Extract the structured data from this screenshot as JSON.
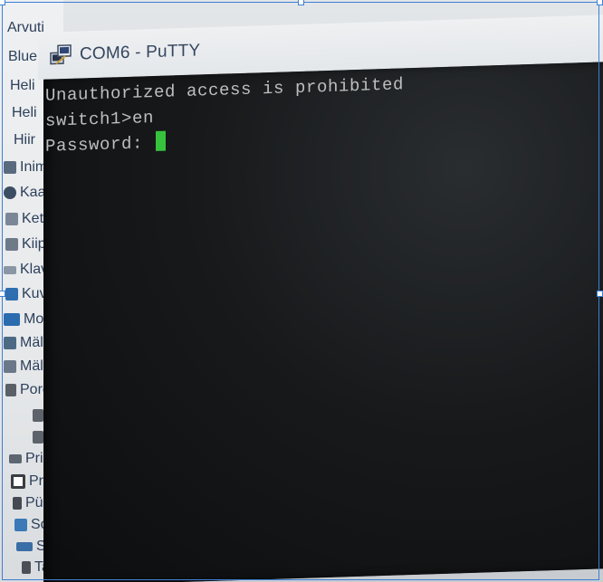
{
  "window": {
    "title": "COM6 - PuTTY",
    "icon": "putty-icon"
  },
  "terminal": {
    "lines": [
      "Unauthorized access is prohibited",
      "switch1>en",
      "Password: "
    ],
    "cursor_color": "#37c23e",
    "text_color": "#bdbfbf",
    "background_color": "#101214"
  },
  "device_manager": {
    "items": [
      {
        "label": "Arvuti",
        "icon": "computer-icon"
      },
      {
        "label": "Blue",
        "icon": "bluetooth-icon"
      },
      {
        "label": "Heli",
        "icon": "audio-icon"
      },
      {
        "label": "Heli",
        "icon": "audio-icon"
      },
      {
        "label": "Hiir",
        "icon": "mouse-icon"
      },
      {
        "label": "Inim",
        "icon": "hid-icon"
      },
      {
        "label": "Kaa",
        "icon": "disk-icon"
      },
      {
        "label": "Kett",
        "icon": "drive-icon"
      },
      {
        "label": "Kiip",
        "icon": "chip-icon"
      },
      {
        "label": "Klav",
        "icon": "keyboard-icon"
      },
      {
        "label": "Kuv",
        "icon": "display-adapter-icon"
      },
      {
        "label": "Mon",
        "icon": "monitor-icon"
      },
      {
        "label": "Mäl",
        "icon": "memory-icon"
      },
      {
        "label": "Mäl",
        "icon": "storage-icon"
      },
      {
        "label": "Porc",
        "icon": "port-icon"
      },
      {
        "label": "",
        "icon": "port-icon"
      },
      {
        "label": "",
        "icon": "port-icon"
      },
      {
        "label": "Prin",
        "icon": "printer-icon"
      },
      {
        "label": "Prot",
        "icon": "processor-icon"
      },
      {
        "label": "Püs",
        "icon": "firmware-icon"
      },
      {
        "label": "Soft",
        "icon": "software-icon"
      },
      {
        "label": "Süst",
        "icon": "system-icon"
      },
      {
        "label": "Tark",
        "icon": "device-icon"
      }
    ]
  },
  "colors": {
    "selection_border": "#3d7fd6",
    "list_text": "#2c3f5a"
  }
}
